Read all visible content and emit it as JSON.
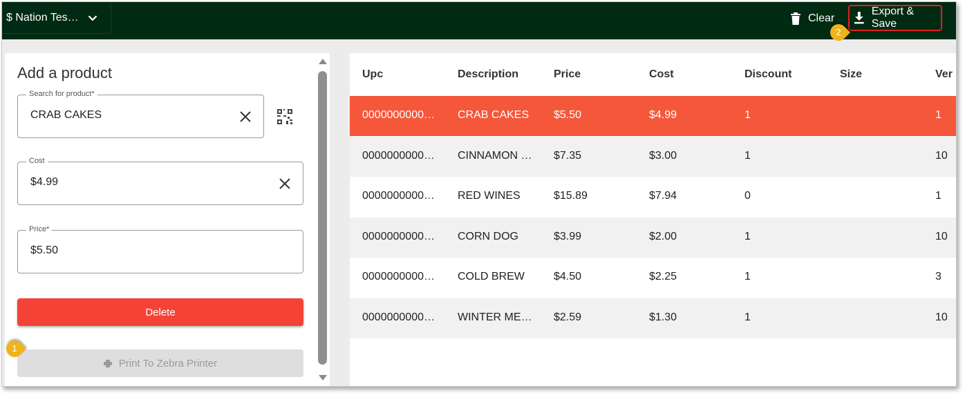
{
  "topbar": {
    "store_name": "$ Nation Tes…",
    "clear_label": "Clear",
    "export_label": "Export & Save"
  },
  "form": {
    "title": "Add a product",
    "search": {
      "label": "Search for product*",
      "value": "CRAB CAKES"
    },
    "cost": {
      "label": "Cost",
      "value": "$4.99"
    },
    "price": {
      "label": "Price*",
      "value": "$5.50"
    },
    "delete_label": "Delete",
    "print_label": "Print To Zebra Printer"
  },
  "table": {
    "columns": [
      "Upc",
      "Description",
      "Price",
      "Cost",
      "Discount",
      "Size",
      "Ver"
    ],
    "rows": [
      {
        "upc": "0000000000…",
        "description": "CRAB CAKES",
        "price": "$5.50",
        "cost": "$4.99",
        "discount": "1",
        "size": "",
        "ver": "1",
        "selected": true
      },
      {
        "upc": "0000000000…",
        "description": "CINNAMON …",
        "price": "$7.35",
        "cost": "$3.00",
        "discount": "1",
        "size": "",
        "ver": "10",
        "selected": false
      },
      {
        "upc": "0000000000…",
        "description": "RED WINES",
        "price": "$15.89",
        "cost": "$7.94",
        "discount": "0",
        "size": "",
        "ver": "1",
        "selected": false
      },
      {
        "upc": "0000000000…",
        "description": "CORN DOG",
        "price": "$3.99",
        "cost": "$2.00",
        "discount": "1",
        "size": "",
        "ver": "10",
        "selected": false
      },
      {
        "upc": "0000000000…",
        "description": "COLD BREW",
        "price": "$4.50",
        "cost": "$2.25",
        "discount": "1",
        "size": "",
        "ver": "3",
        "selected": false
      },
      {
        "upc": "0000000000…",
        "description": "WINTER ME…",
        "price": "$2.59",
        "cost": "$1.30",
        "discount": "1",
        "size": "",
        "ver": "10",
        "selected": false
      }
    ]
  },
  "callouts": [
    "1",
    "2"
  ],
  "colors": {
    "topbar": "#012a12",
    "selected_row": "#f5573a",
    "delete_button": "#f44336",
    "highlight_border": "#e02020",
    "callout": "#f0b418"
  },
  "icons": [
    "chevron-down-icon",
    "trash-icon",
    "download-icon",
    "close-icon",
    "qr-scan-icon",
    "printer-icon"
  ]
}
